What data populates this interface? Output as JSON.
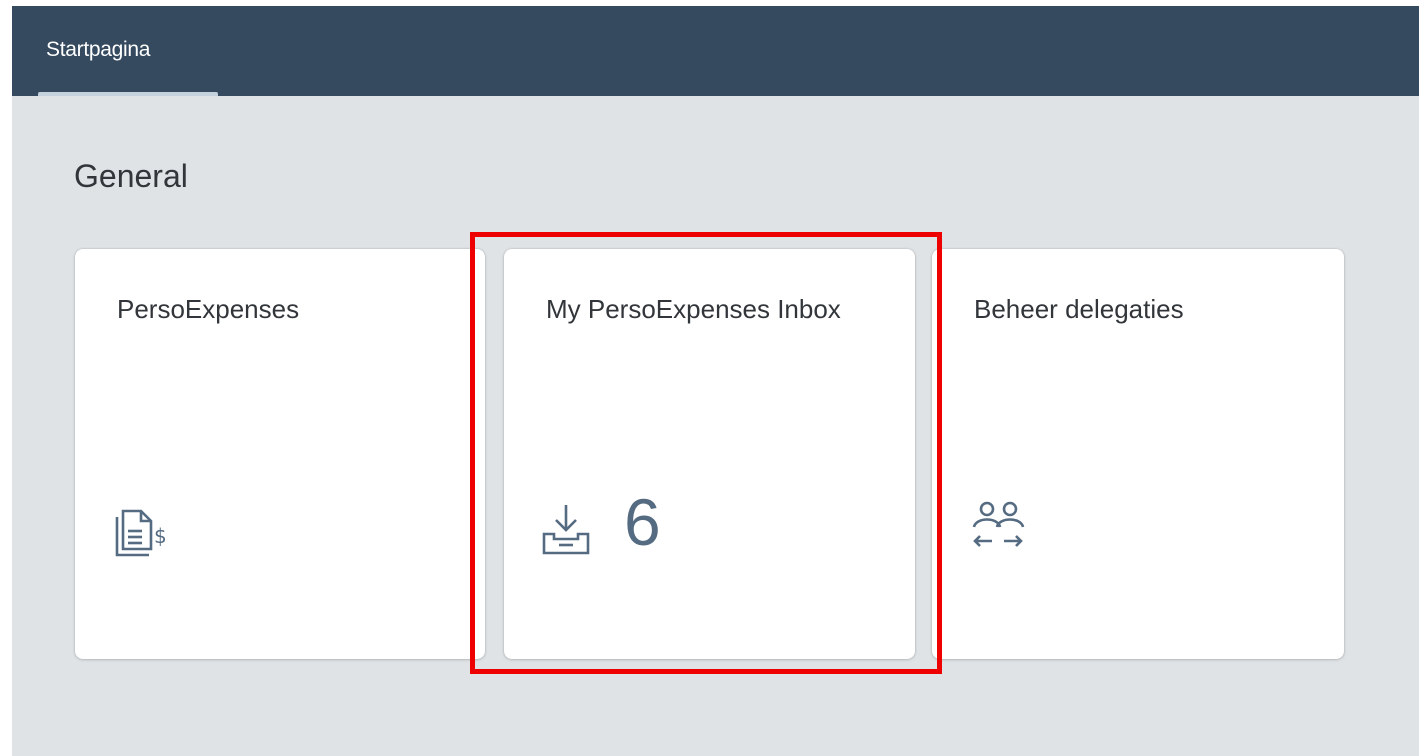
{
  "shell": {
    "active_tab": "Startpagina"
  },
  "section": {
    "title": "General"
  },
  "tiles": [
    {
      "title": "PersoExpenses",
      "icon": "expense-report-icon"
    },
    {
      "title": "My PersoExpenses Inbox",
      "icon": "inbox-download-icon",
      "count": "6"
    },
    {
      "title": "Beheer delegaties",
      "icon": "user-delegation-icon"
    }
  ],
  "annotation": {
    "highlight_color": "#ee0000",
    "highlighted_tile": "My PersoExpenses Inbox"
  },
  "colors": {
    "shell": "#354a5f",
    "background": "#dfe3e6",
    "icon": "#556b82",
    "text": "#32363a"
  }
}
